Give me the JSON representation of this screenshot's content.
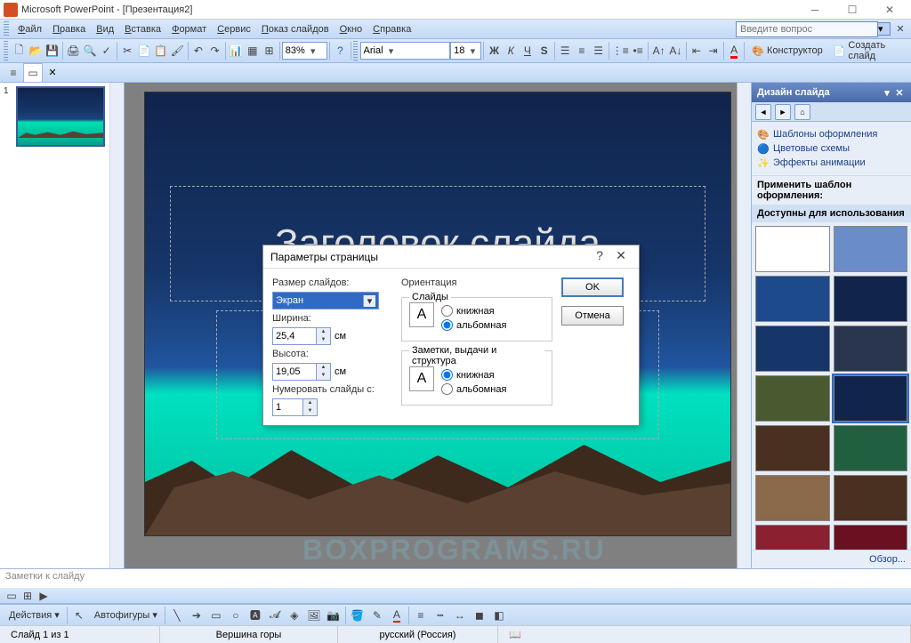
{
  "titlebar": {
    "title": "Microsoft PowerPoint - [Презентация2]"
  },
  "menu": {
    "file": "Файл",
    "edit": "Правка",
    "view": "Вид",
    "insert": "Вставка",
    "format": "Формат",
    "tools": "Сервис",
    "slideshow": "Показ слайдов",
    "window": "Окно",
    "help": "Справка",
    "question_placeholder": "Введите вопрос"
  },
  "toolbar": {
    "zoom": "83%",
    "font": "Arial",
    "size": "18",
    "designer": "Конструктор",
    "newslide": "Создать слайд"
  },
  "thumb": {
    "num": "1"
  },
  "slide": {
    "title": "Заголовок слайда"
  },
  "dialog": {
    "title": "Параметры страницы",
    "size_label": "Размер слайдов:",
    "size_value": "Экран",
    "width_label": "Ширина:",
    "width_value": "25,4",
    "width_unit": "см",
    "height_label": "Высота:",
    "height_value": "19,05",
    "height_unit": "см",
    "number_label": "Нумеровать слайды с:",
    "number_value": "1",
    "orient_label": "Ориентация",
    "slides_label": "Слайды",
    "portrait": "книжная",
    "landscape": "альбомная",
    "notes_label": "Заметки, выдачи и структура",
    "ok": "OK",
    "cancel": "Отмена"
  },
  "taskpane": {
    "title": "Дизайн слайда",
    "link1": "Шаблоны оформления",
    "link2": "Цветовые схемы",
    "link3": "Эффекты анимации",
    "apply": "Применить шаблон оформления:",
    "available": "Доступны для использования",
    "browse": "Обзор..."
  },
  "notes": {
    "placeholder": "Заметки к слайду"
  },
  "drawbar": {
    "actions": "Действия",
    "autoshapes": "Автофигуры"
  },
  "status": {
    "slide": "Слайд 1 из 1",
    "design": "Вершина горы",
    "lang": "русский (Россия)"
  },
  "watermark": "BOXPROGRAMS.RU",
  "tpl_colors": [
    "#fff",
    "#6a8cc8",
    "#1d4a8b",
    "#10244c",
    "#163568",
    "#2a3550",
    "#4a5a30",
    "#10244c",
    "#4a3020",
    "#206040",
    "#8a6a4a",
    "#4a3020",
    "#8a2030",
    "#6a1020",
    "#8a6020",
    "#201510"
  ]
}
